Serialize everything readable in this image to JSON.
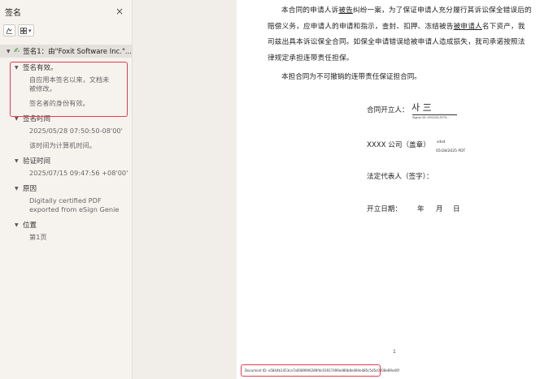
{
  "sidebar": {
    "title": "签名",
    "close_glyph": "×",
    "toolbar": {
      "tool_icon": "signature-tool-icon",
      "view_icon": "grid-view-icon",
      "view_caret": "▾"
    },
    "root": {
      "label": "签名1：由\"Foxit Software Inc.\"..."
    },
    "nodes": [
      {
        "label": "签名有效。",
        "lines": [
          "自应用本签名以来，文档未被修改。",
          "签名者的身份有效。"
        ]
      },
      {
        "label": "签名时间",
        "lines": [
          "2025/05/28 07:50:50-08'00'",
          "该时间为计算机时间。"
        ]
      },
      {
        "label": "验证时间",
        "lines": [
          "2025/07/15 09:47:56 +08'00'"
        ]
      },
      {
        "label": "原因",
        "lines": [
          "Digitally certified PDF exported from eSign Genie"
        ]
      },
      {
        "label": "位置",
        "lines": [
          "第1页"
        ]
      }
    ]
  },
  "document": {
    "para1": {
      "indent_start": "本合同的申请人诉",
      "ul1": "被告",
      "mid1": "纠纷一案，为了保证申请人充分履行其诉讼保全错误后的赔偿义务，应申请人的申请和指示，查封、扣押、冻结被告",
      "ul2": "被申请人",
      "end": "名下资产，我司兹出具本诉讼保全合同。如保全申请错误给被申请人造成损失，我司承诺按照法律规定承担连带责任担保。"
    },
    "para2": "本担合同为不可撤销的连带责任保证担合同。",
    "opener_label": "合同开立人：",
    "opener_signature": "사 三",
    "signer_id": "Signer ID: HYGOOL3Y75...",
    "company_label": "XXXX 公司（盖章）",
    "stamp_name": "sdsd",
    "stamp_date": "05/28/2025 PDT",
    "legal_rep_label": "法定代表人（签字）：",
    "date_label": "开立日期：",
    "year": "年",
    "month": "月",
    "day": "日",
    "page_number": "1",
    "document_id": "Document ID: e5844b1453ca7a0089906289f4c03917499ed80b8ed94e485c5d5c0858e89e40f"
  },
  "colors": {
    "highlight_box": "#e8394d",
    "sidebar_bg": "#f6f3ef",
    "valid_icon": "#3c8a3c"
  }
}
